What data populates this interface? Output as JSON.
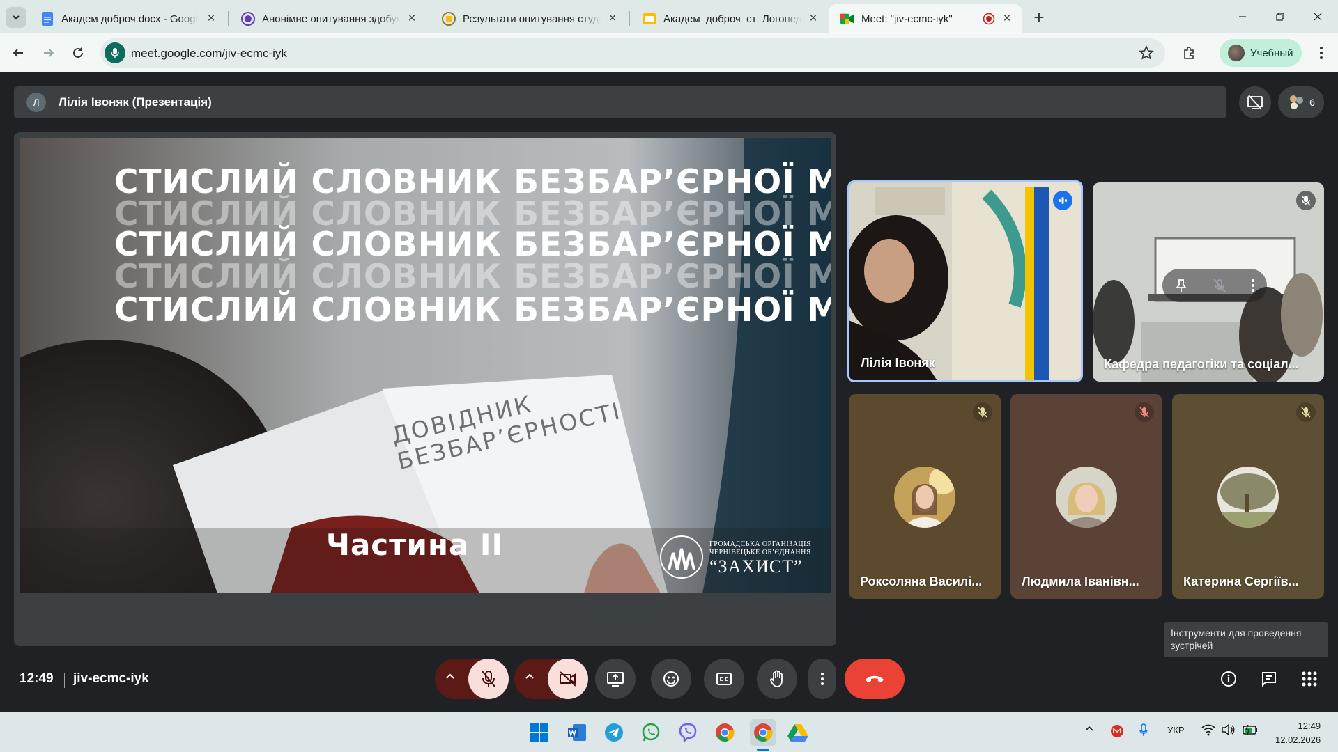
{
  "browser": {
    "tabs": [
      {
        "title": "Академ доброч.docx - Google",
        "icon": "docs-icon"
      },
      {
        "title": "Анонімне опитування здобува",
        "icon": "forms-icon"
      },
      {
        "title": "Результати опитування студен",
        "icon": "sheets-icon"
      },
      {
        "title": "Академ_доброч_ст_Логопедія",
        "icon": "slides-icon"
      },
      {
        "title": "Meet: \"jiv-ecmc-iyk\"",
        "icon": "meet-icon",
        "active": true
      }
    ],
    "url": "meet.google.com/jiv-ecmc-iyk",
    "profile_label": "Учебный"
  },
  "meet": {
    "presenter": {
      "initial": "Л",
      "label": "Лілія Івоняк (Презентація)"
    },
    "participants_count": "6",
    "slide": {
      "heading_lines": [
        "СТИСЛИЙ СЛОВНИК БЕЗБАР’ЄРНОЇ МОВИ",
        "СТИСЛИЙ СЛОВНИК БЕЗБАР’ЄРНОЇ МОВИ",
        "СТИСЛИЙ СЛОВНИК БЕЗБАР’ЄРНОЇ МОВИ",
        "СТИСЛИЙ СЛОВНИК БЕЗБАР’ЄРНОЇ МОВИ",
        "СТИСЛИЙ СЛОВНИК БЕЗБАР’ЄРНОЇ МОВИ"
      ],
      "book_title": "ДОВІДНИК\nБЕЗБАР’ЄРНОСТІ",
      "part": "Частина  II",
      "org_small_1": "ГРОМАДСЬКА ОРГАНІЗАЦІЯ",
      "org_small_2": "ЧЕРНІВЕЦЬКЕ ОБ’ЄДНАННЯ",
      "org_big": "“ЗАХИСТ”"
    },
    "tiles": [
      {
        "name": "Лілія Івоняк",
        "speaking": true
      },
      {
        "name": "Кафедра педагогіки та соціал...",
        "muted": true
      },
      {
        "name": "Роксоляна Василі...",
        "muted": true
      },
      {
        "name": "Людмила Іванівн...",
        "muted": true
      },
      {
        "name": "Катерина Сергіїв...",
        "muted": true
      }
    ],
    "tooltip": "Інструменти для проведення зустрічей",
    "time": "12:49",
    "meeting_code": "jiv-ecmc-iyk",
    "colors": {
      "end_call": "#ea4335",
      "muted_bg": "#f9dedc",
      "accent": "#8ab4f8"
    }
  },
  "taskbar": {
    "language": "УКР",
    "time": "12:49",
    "date": "12.02.2026"
  }
}
